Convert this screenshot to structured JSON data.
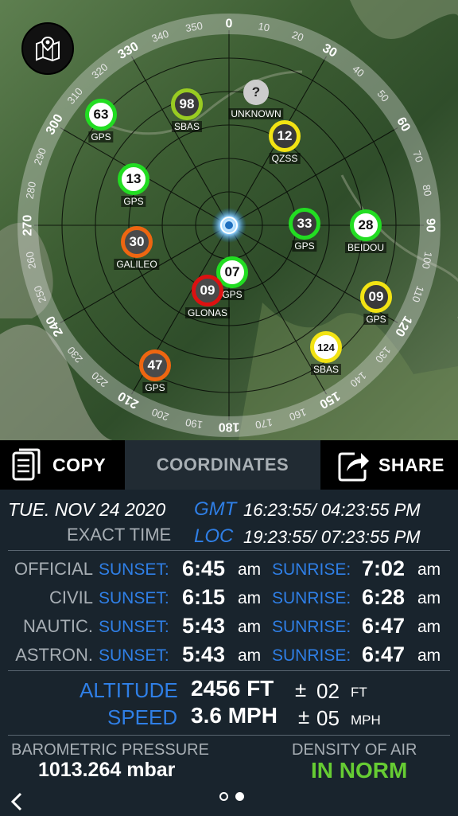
{
  "sky": {
    "map_button_icon": "map-pin-icon",
    "angle_labels": [
      "0",
      "10",
      "20",
      "30",
      "40",
      "50",
      "60",
      "70",
      "80",
      "90",
      "100",
      "110",
      "120",
      "130",
      "140",
      "150",
      "160",
      "170",
      "180",
      "190",
      "200",
      "210",
      "220",
      "230",
      "240",
      "250",
      "260",
      "270",
      "280",
      "290",
      "300",
      "310",
      "320",
      "330",
      "340",
      "350"
    ],
    "satellites": [
      {
        "num": "63",
        "label": "GPS",
        "ring": "#22dd22",
        "fill": "#ffffff",
        "text": "#111111"
      },
      {
        "num": "98",
        "label": "SBAS",
        "ring": "#99cc22",
        "fill": "#3a3a3a",
        "text": "#ffffff"
      },
      {
        "num": "?",
        "label": "UNKNOWN",
        "ring": "#999999",
        "fill": "#cccccc",
        "text": "#222222"
      },
      {
        "num": "12",
        "label": "QZSS",
        "ring": "#f2e313",
        "fill": "#3a3a3a",
        "text": "#ffffff"
      },
      {
        "num": "13",
        "label": "GPS",
        "ring": "#22dd22",
        "fill": "#ffffff",
        "text": "#111111"
      },
      {
        "num": "30",
        "label": "GALILEO",
        "ring": "#ee6611",
        "fill": "#4a4a4a",
        "text": "#ffffff"
      },
      {
        "num": "33",
        "label": "GPS",
        "ring": "#22dd22",
        "fill": "#3a3a3a",
        "text": "#ffffff"
      },
      {
        "num": "28",
        "label": "BEIDOU",
        "ring": "#22dd22",
        "fill": "#ffffff",
        "text": "#111111"
      },
      {
        "num": "07",
        "label": "GPS",
        "ring": "#22dd22",
        "fill": "#ffffff",
        "text": "#111111"
      },
      {
        "num": "09",
        "label": "GLONAS",
        "ring": "#dd1111",
        "fill": "#4a4a4a",
        "text": "#ffffff"
      },
      {
        "num": "09",
        "label": "GPS",
        "ring": "#f2e313",
        "fill": "#3a3a3a",
        "text": "#ffffff"
      },
      {
        "num": "124",
        "label": "SBAS",
        "ring": "#f2e313",
        "fill": "#ffffff",
        "text": "#111111"
      },
      {
        "num": "47",
        "label": "GPS",
        "ring": "#ee6611",
        "fill": "#4a4a4a",
        "text": "#ffffff"
      }
    ]
  },
  "toolbar": {
    "copy_label": "COPY",
    "tab_label": "COORDINATES",
    "share_label": "SHARE",
    "copy_icon": "copy-icon",
    "share_icon": "share-icon"
  },
  "time": {
    "date": "TUE. NOV 24 2020",
    "exact_label": "EXACT TIME",
    "gmt_label": "GMT",
    "gmt_value": "16:23:55/ 04:23:55 PM",
    "loc_label": "LOC",
    "loc_value": "19:23:55/ 07:23:55 PM"
  },
  "sun": {
    "sunset_label": "SUNSET:",
    "sunrise_label": "SUNRISE:",
    "unit": "am",
    "rows": [
      {
        "name": "OFFICIAL",
        "sunset": "6:45",
        "sunrise": "7:02"
      },
      {
        "name": "CIVIL",
        "sunset": "6:15",
        "sunrise": "6:28"
      },
      {
        "name": "NAUTIC.",
        "sunset": "5:43",
        "sunrise": "6:47"
      },
      {
        "name": "ASTRON.",
        "sunset": "5:43",
        "sunrise": "6:47"
      }
    ]
  },
  "altitude": {
    "label": "ALTITUDE",
    "value": "2456 FT",
    "pm": "±",
    "acc": "02",
    "unit": "FT"
  },
  "speed": {
    "label": "SPEED",
    "value": "3.6 MPH",
    "pm": "±",
    "acc": "05",
    "unit": "MPH"
  },
  "pressure": {
    "label": "BAROMETRIC PRESSURE",
    "value": "1013.264 mbar"
  },
  "air": {
    "label": "DENSITY OF AIR",
    "value": "IN NORM",
    "color": "#66cc33"
  },
  "nav": {
    "back_icon": "chevron-left-icon",
    "page_count": 2,
    "current_page": 2
  }
}
